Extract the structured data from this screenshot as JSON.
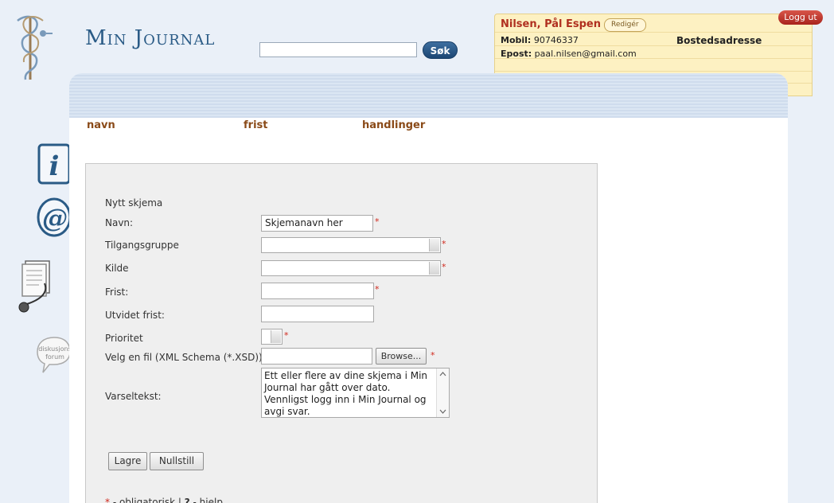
{
  "brand": {
    "title": "Min Journal"
  },
  "search": {
    "value": "",
    "placeholder": "",
    "button_label": "Søk"
  },
  "user": {
    "name": "Nilsen, Pål Espen",
    "edit_label": "Redigér",
    "mobile_label": "Mobil:",
    "mobile": "90746337",
    "email_label": "Epost:",
    "email": "paal.nilsen@gmail.com",
    "address_label": "Bostedsadresse",
    "logout_label": "Logg ut"
  },
  "sidebar": {
    "icons": [
      "info-icon",
      "email-at-icon",
      "document-stethoscope-icon",
      "forum-bubble-icon"
    ],
    "forum_label": "diskusjons forum"
  },
  "table": {
    "headers": [
      "navn",
      "frist",
      "handlinger"
    ]
  },
  "form": {
    "title": "Nytt skjema",
    "fields": {
      "name": {
        "label": "Navn:",
        "value": "Skjemanavn her"
      },
      "access_group": {
        "label": "Tilgangsgruppe",
        "value": ""
      },
      "source": {
        "label": "Kilde",
        "value": ""
      },
      "deadline": {
        "label": "Frist:",
        "value": ""
      },
      "extended_deadline": {
        "label": "Utvidet frist:",
        "value": ""
      },
      "priority": {
        "label": "Prioritet",
        "value": ""
      },
      "file": {
        "label": "Velg en fil (XML Schema (*.XSD))",
        "value": "",
        "browse_label": "Browse..."
      },
      "notice": {
        "label": "Varseltekst:",
        "value": "Ett eller flere av dine skjema i Min Journal har gått over dato. Vennligst logg inn i Min Journal og avgi svar."
      }
    },
    "save_label": "Lagre",
    "reset_label": "Nullstill",
    "required_mark": "*",
    "legend_required": " - obligatorisk | ",
    "legend_help_mark": "?",
    "legend_help": " - hjelp"
  },
  "colors": {
    "accent": "#2a5b86",
    "required": "#d0281c",
    "column_header": "#8a4a18",
    "user_name": "#b03020"
  }
}
